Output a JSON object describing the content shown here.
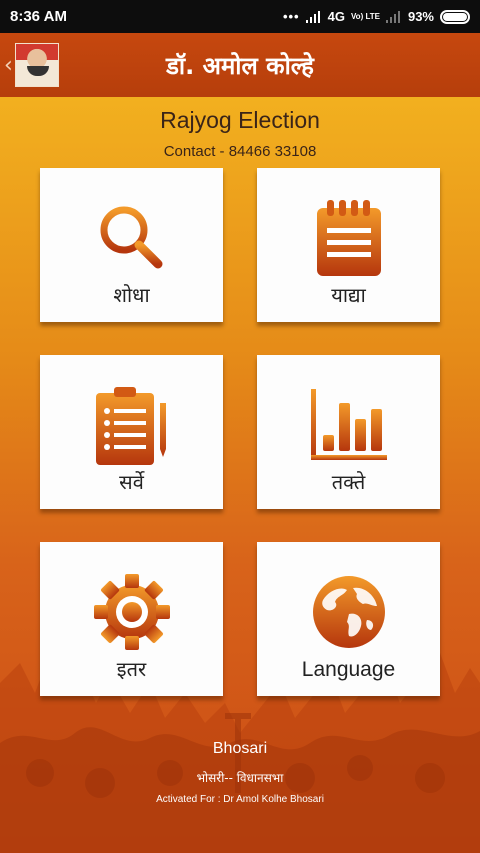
{
  "status_bar": {
    "time": "8:36 AM",
    "signal_text": "4G",
    "carrier_badge": "Vo) LTE",
    "battery": "93%"
  },
  "app_bar": {
    "title": "डॉ. अमोल कोल्हे"
  },
  "header": {
    "app_name": "Rajyog Election",
    "contact": "Contact - 84466 33108"
  },
  "tiles": [
    {
      "label": "शोधा",
      "icon": "search-icon"
    },
    {
      "label": "याद्या",
      "icon": "notepad-icon"
    },
    {
      "label": "सर्वे",
      "icon": "clipboard-icon"
    },
    {
      "label": "तक्ते",
      "icon": "bar-chart-icon"
    },
    {
      "label": "इतर",
      "icon": "gear-icon"
    },
    {
      "label": "Language",
      "icon": "globe-icon"
    }
  ],
  "footer": {
    "place": "Bhosari",
    "constituency": "भोसरी-- विधानसभा",
    "activation": "Activated For : Dr Amol Kolhe Bhosari"
  },
  "colors": {
    "app_bar": "#c6480e",
    "icon_gradient_top": "#f08a22",
    "icon_gradient_bottom": "#b83a0e",
    "background_top": "#f2b01f",
    "background_bottom": "#c94a14"
  }
}
